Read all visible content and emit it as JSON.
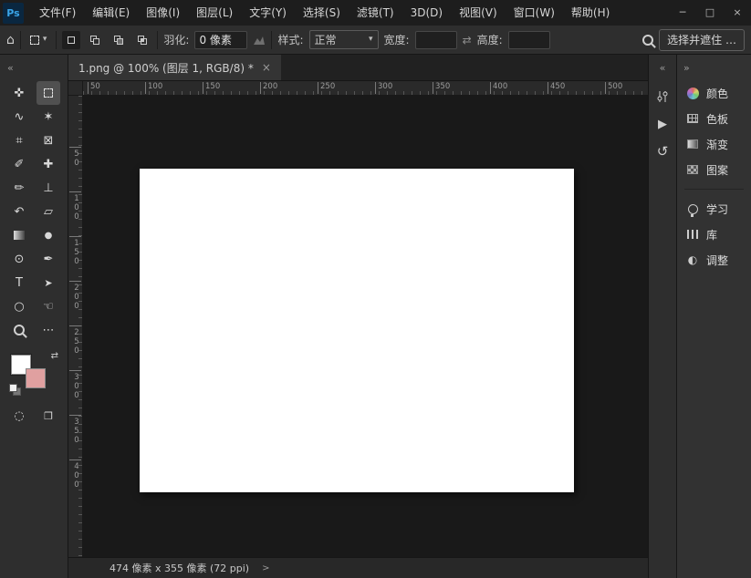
{
  "window": {
    "logo": "Ps",
    "minimize": "─",
    "maximize": "□",
    "close": "×"
  },
  "menubar": {
    "items": [
      "文件(F)",
      "编辑(E)",
      "图像(I)",
      "图层(L)",
      "文字(Y)",
      "选择(S)",
      "滤镜(T)",
      "3D(D)",
      "视图(V)",
      "窗口(W)",
      "帮助(H)"
    ]
  },
  "options": {
    "feather_label": "羽化:",
    "feather_value": "0 像素",
    "style_label": "样式:",
    "style_value": "正常",
    "width_label": "宽度:",
    "width_value": "",
    "height_label": "高度:",
    "height_value": "",
    "select_and_mask": "选择并遮住 …"
  },
  "tab": {
    "title": "1.png @ 100% (图层 1, RGB/8) *",
    "close": "×"
  },
  "rulers": {
    "h": [
      "50",
      "100",
      "150",
      "200",
      "250",
      "300",
      "350",
      "400",
      "450",
      "500"
    ],
    "v": [
      "50",
      "100",
      "150",
      "200",
      "250",
      "300",
      "350",
      "400"
    ]
  },
  "icons": {
    "home": "⌂",
    "caret": "▾",
    "collapse": "«",
    "expand": "»",
    "swap": "⇄",
    "move": "✜",
    "lasso": "∿",
    "quick-select": "✶",
    "crop": "⌗",
    "frame": "⊠",
    "eyedropper": "✐",
    "healing": "✚",
    "brush": "✏",
    "clone-stamp": "⊥",
    "history-brush": "↶",
    "eraser": "▱",
    "blur": "●",
    "dodge": "⊙",
    "pen": "✒",
    "type": "T",
    "path-select": "➤",
    "ellipse": "○",
    "hand": "☜",
    "ellipsis": "⋯",
    "quick-mask": "◌",
    "screen-mode": "❐",
    "play": "▶",
    "history": "↺",
    "adjustments": "◐"
  },
  "panels": {
    "primary": [
      {
        "label": "颜色"
      },
      {
        "label": "色板"
      },
      {
        "label": "渐变"
      },
      {
        "label": "图案"
      }
    ],
    "secondary": [
      {
        "label": "学习"
      },
      {
        "label": "库"
      },
      {
        "label": "调整"
      }
    ]
  },
  "status": {
    "dimensions": "474 像素 x 355 像素 (72 ppi)",
    "chevron": ">"
  },
  "colors": {
    "foreground": "#ffffff",
    "background": "#e0a0a0",
    "accent": "#31a8ff"
  }
}
